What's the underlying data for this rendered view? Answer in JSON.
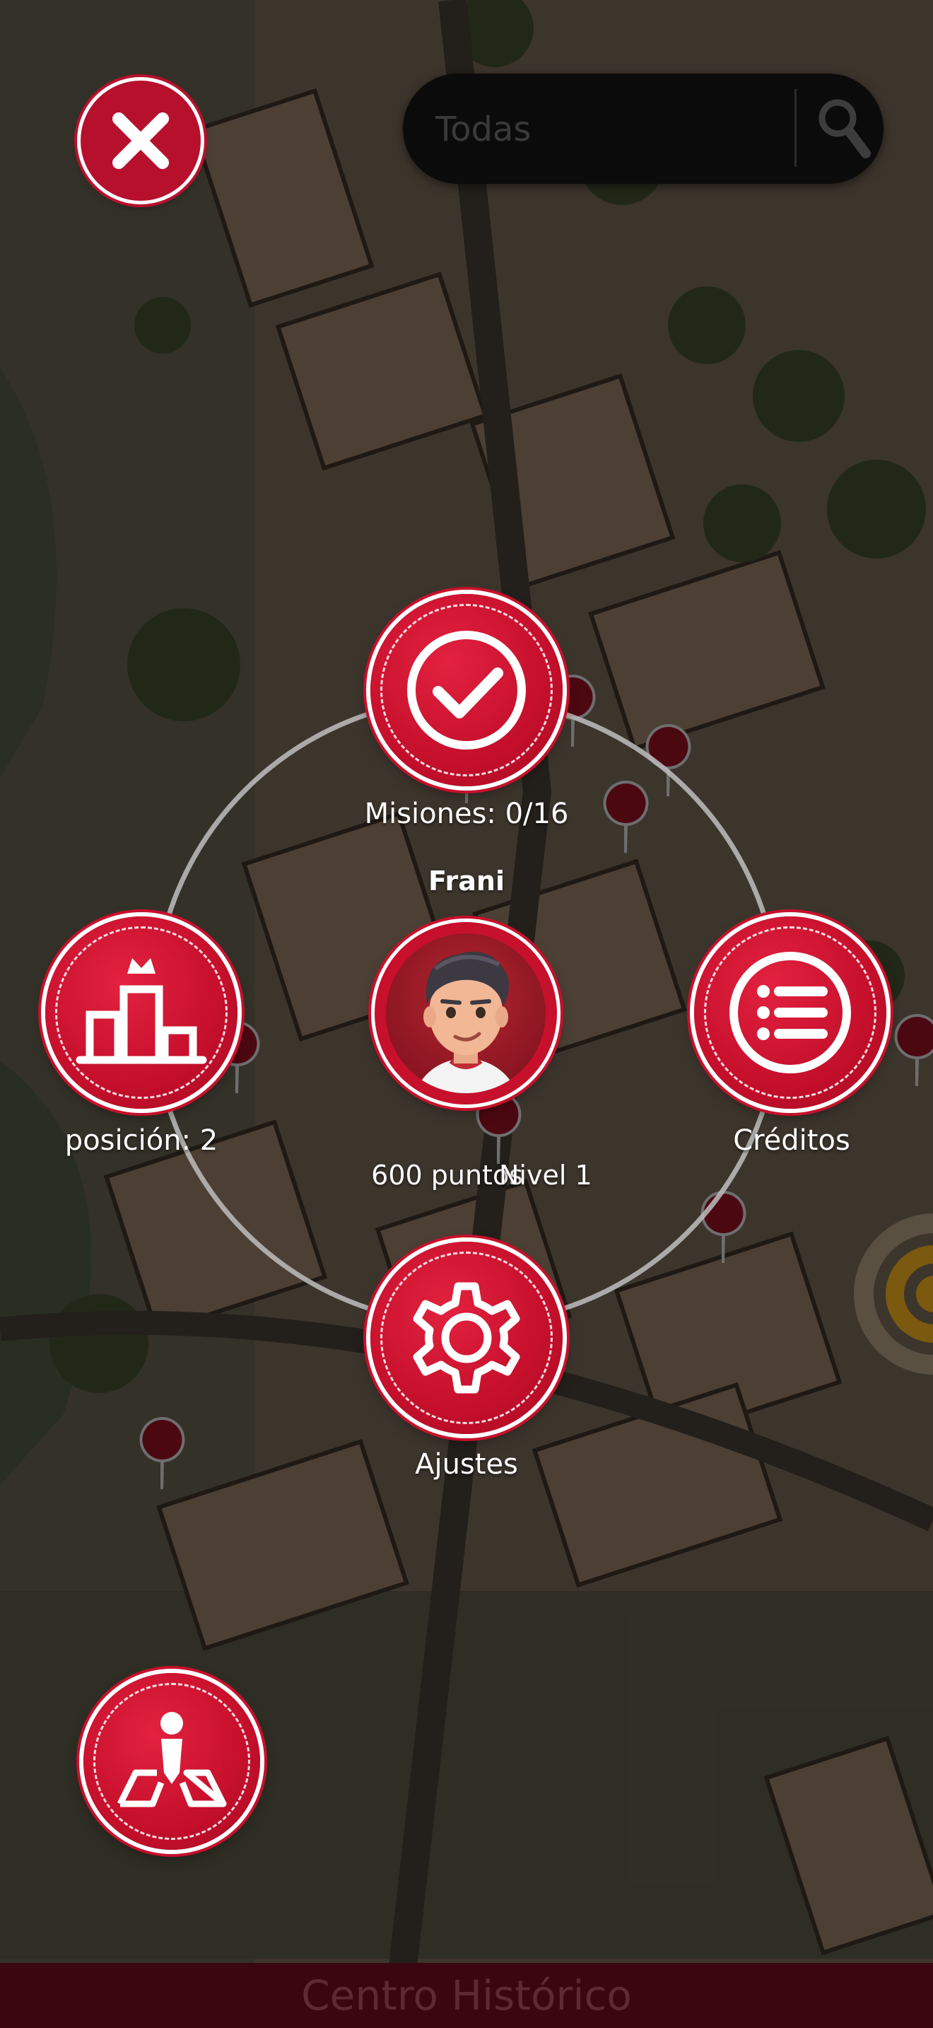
{
  "search": {
    "placeholder": "Todas"
  },
  "profile": {
    "username": "Frani",
    "points": "600 puntos",
    "level": "Nivel 1"
  },
  "menu": {
    "missions_label": "Misiones: 0/16",
    "ranking_label": "posición: 2",
    "credits_label": "Créditos",
    "settings_label": "Ajustes"
  },
  "bottom_bar": {
    "zone_name": "Centro Histórico"
  },
  "icons": {
    "close": "close-icon",
    "search": "search-icon",
    "missions": "checkmark-icon",
    "ranking": "podium-crown-icon",
    "credits": "list-icon",
    "settings": "gear-icon",
    "map_locate": "map-person-icon",
    "map_pins": "map-pin-icon"
  },
  "colors": {
    "accent_red": "#c7102c",
    "bottom_bar": "#3a0710",
    "search_bg": "#0b0b0b",
    "location_ring": "#e0a21c"
  }
}
